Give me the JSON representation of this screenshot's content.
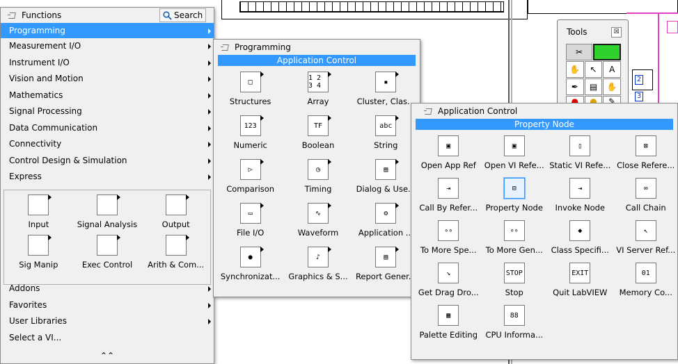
{
  "menu": {
    "title": "Functions",
    "search_label": "Search",
    "items_top": [
      {
        "label": "Programming",
        "selected": true,
        "submenu": true
      },
      {
        "label": "Measurement I/O",
        "submenu": true
      },
      {
        "label": "Instrument I/O",
        "submenu": true
      },
      {
        "label": "Vision and Motion",
        "submenu": true
      },
      {
        "label": "Mathematics",
        "submenu": true
      },
      {
        "label": "Signal Processing",
        "submenu": true
      },
      {
        "label": "Data Communication",
        "submenu": true
      },
      {
        "label": "Connectivity",
        "submenu": true
      },
      {
        "label": "Control Design & Simulation",
        "submenu": true
      },
      {
        "label": "Express",
        "submenu": true
      }
    ],
    "express_items": [
      {
        "label": "Input",
        "icon": "input-icon"
      },
      {
        "label": "Signal Analysis",
        "icon": "signal-analysis-icon"
      },
      {
        "label": "Output",
        "icon": "output-icon"
      },
      {
        "label": "Sig Manip",
        "icon": "sig-manip-icon"
      },
      {
        "label": "Exec Control",
        "icon": "exec-control-icon"
      },
      {
        "label": "Arith & Com...",
        "icon": "arith-icon"
      }
    ],
    "items_bottom": [
      {
        "label": "Addons",
        "submenu": true
      },
      {
        "label": "Favorites",
        "submenu": true
      },
      {
        "label": "User Libraries",
        "submenu": true
      },
      {
        "label": "Select a VI...",
        "submenu": false
      }
    ],
    "scroll_glyph": "⌃⌃"
  },
  "programming": {
    "title": "Programming",
    "category": "Application Control",
    "items": [
      {
        "label": "Structures"
      },
      {
        "label": "Array"
      },
      {
        "label": "Cluster, Clas..."
      },
      {
        "label": "Numeric"
      },
      {
        "label": "Boolean"
      },
      {
        "label": "String"
      },
      {
        "label": "Comparison"
      },
      {
        "label": "Timing"
      },
      {
        "label": "Dialog & Use..."
      },
      {
        "label": "File I/O"
      },
      {
        "label": "Waveform"
      },
      {
        "label": "Application ..."
      },
      {
        "label": "Synchronizat..."
      },
      {
        "label": "Graphics & S..."
      },
      {
        "label": "Report Gener..."
      }
    ],
    "icon_glyphs": [
      "□",
      "1 2\n3 4",
      "▪",
      "123",
      "TF",
      "abc",
      "▷",
      "◷",
      "▤",
      "▭",
      "∿",
      "⚙",
      "●",
      "♪",
      "▤"
    ]
  },
  "appcontrol": {
    "title": "Application Control",
    "category": "Property Node",
    "items": [
      {
        "label": "Open App Ref"
      },
      {
        "label": "Open VI Refe..."
      },
      {
        "label": "Static VI Refe..."
      },
      {
        "label": "Close Refere..."
      },
      {
        "label": "Call By Refer..."
      },
      {
        "label": "Property Node"
      },
      {
        "label": "Invoke Node"
      },
      {
        "label": "Call Chain"
      },
      {
        "label": "To More Spe..."
      },
      {
        "label": "To More Gen..."
      },
      {
        "label": "Class Specifi..."
      },
      {
        "label": "VI Server Ref..."
      },
      {
        "label": "Get Drag Dro..."
      },
      {
        "label": "Stop"
      },
      {
        "label": "Quit LabVIEW"
      },
      {
        "label": "Memory Co..."
      },
      {
        "label": "Palette Editing"
      },
      {
        "label": "CPU Informa..."
      }
    ],
    "icon_glyphs": [
      "▣",
      "▣",
      "▯",
      "⊠",
      "⇥",
      "⊟",
      "⇥",
      "∞",
      "∘∘",
      "∘∘",
      "◆",
      "↖",
      "↘",
      "STOP",
      "EXIT",
      "01",
      "▦",
      "88"
    ]
  },
  "tools": {
    "title": "Tools",
    "close_glyph": "☒",
    "rows": [
      [
        "✂",
        "▬"
      ],
      [
        "✋",
        "↖",
        "A"
      ],
      [
        "✒",
        "▤",
        "✋"
      ],
      [
        "●",
        "●",
        "✎"
      ]
    ]
  },
  "colors": {
    "selection": "#3399ff",
    "palette_bg": "#f0f0f0",
    "wire_pink": "#e040c0"
  }
}
